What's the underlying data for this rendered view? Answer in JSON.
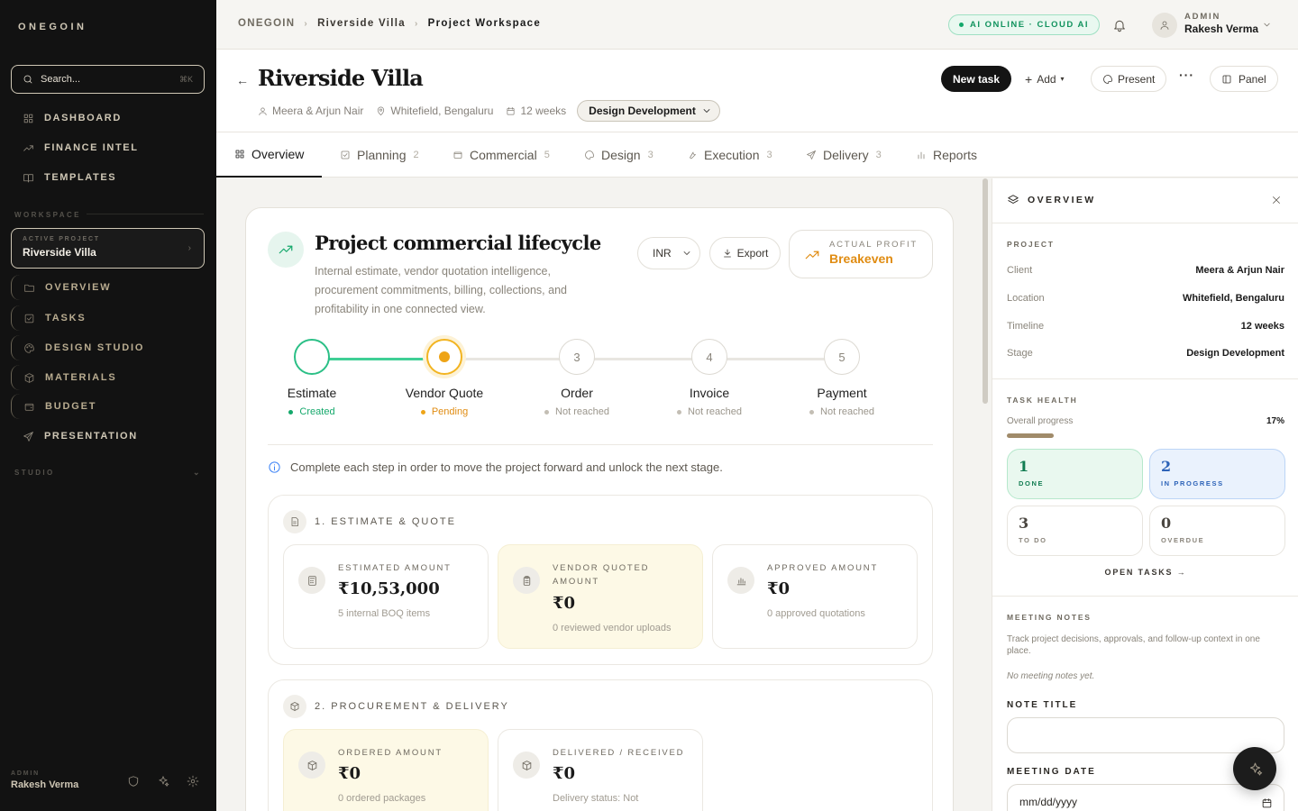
{
  "sidebar": {
    "brand": "ONEGOIN",
    "search_placeholder": "Search...",
    "search_shortcut": "⌘K",
    "nav": [
      {
        "label": "DASHBOARD",
        "icon": "grid-icon"
      },
      {
        "label": "FINANCE INTEL",
        "icon": "trend-icon"
      },
      {
        "label": "TEMPLATES",
        "icon": "book-icon"
      }
    ],
    "workspace_label": "WORKSPACE",
    "active_project_label": "ACTIVE PROJECT",
    "active_project_name": "Riverside Villa",
    "project_nav": [
      {
        "label": "OVERVIEW",
        "icon": "folder-icon"
      },
      {
        "label": "TASKS",
        "icon": "check-square-icon"
      },
      {
        "label": "DESIGN STUDIO",
        "icon": "palette-icon"
      },
      {
        "label": "MATERIALS",
        "icon": "box-icon"
      },
      {
        "label": "BUDGET",
        "icon": "wallet-icon"
      },
      {
        "label": "PRESENTATION",
        "icon": "send-icon"
      }
    ],
    "studio_label": "STUDIO",
    "footer_role": "ADMIN",
    "footer_user": "Rakesh Verma"
  },
  "topbar": {
    "breadcrumbs": [
      "ONEGOIN",
      "Riverside Villa",
      "Project Workspace"
    ],
    "ai_status": "AI ONLINE · CLOUD AI",
    "user_role": "ADMIN",
    "user_name": "Rakesh Verma"
  },
  "header": {
    "back": "←",
    "title": "Riverside Villa",
    "client": "Meera & Arjun Nair",
    "location": "Whitefield, Bengaluru",
    "duration": "12 weeks",
    "stage": "Design Development",
    "new_task": "New task",
    "add": "Add",
    "present": "Present",
    "more": "···",
    "panel": "Panel"
  },
  "tabs": [
    {
      "label": "Overview",
      "count": ""
    },
    {
      "label": "Planning",
      "count": "2"
    },
    {
      "label": "Commercial",
      "count": "5"
    },
    {
      "label": "Design",
      "count": "3"
    },
    {
      "label": "Execution",
      "count": "3"
    },
    {
      "label": "Delivery",
      "count": "3"
    },
    {
      "label": "Reports",
      "count": ""
    }
  ],
  "lifecycle": {
    "title": "Project commercial lifecycle",
    "description": "Internal estimate, vendor quotation intelligence, procurement commitments, billing, collections, and profitability in one connected view.",
    "currency": "INR",
    "export": "Export",
    "profit_label": "ACTUAL PROFIT",
    "profit_value": "Breakeven",
    "steps": [
      {
        "num": "",
        "name": "Estimate",
        "status": "Created"
      },
      {
        "num": "",
        "name": "Vendor Quote",
        "status": "Pending"
      },
      {
        "num": "3",
        "name": "Order",
        "status": "Not reached"
      },
      {
        "num": "4",
        "name": "Invoice",
        "status": "Not reached"
      },
      {
        "num": "5",
        "name": "Payment",
        "status": "Not reached"
      }
    ],
    "info": "Complete each step in order to move the project forward and unlock the next stage.",
    "group1": {
      "title": "1. ESTIMATE & QUOTE",
      "cards": [
        {
          "label": "ESTIMATED AMOUNT",
          "value": "₹10,53,000",
          "sub": "5 internal BOQ items"
        },
        {
          "label": "VENDOR QUOTED AMOUNT",
          "value": "₹0",
          "sub": "0 reviewed vendor uploads"
        },
        {
          "label": "APPROVED AMOUNT",
          "value": "₹0",
          "sub": "0 approved quotations"
        }
      ]
    },
    "group2": {
      "title": "2. PROCUREMENT & DELIVERY",
      "cards": [
        {
          "label": "ORDERED AMOUNT",
          "value": "₹0",
          "sub": "0 ordered packages"
        },
        {
          "label": "DELIVERED / RECEIVED",
          "value": "₹0",
          "sub": "Delivery status: Not"
        }
      ]
    }
  },
  "panel": {
    "title": "OVERVIEW",
    "project_label": "PROJECT",
    "rows": [
      {
        "k": "Client",
        "v": "Meera & Arjun Nair"
      },
      {
        "k": "Location",
        "v": "Whitefield, Bengaluru"
      },
      {
        "k": "Timeline",
        "v": "12 weeks"
      },
      {
        "k": "Stage",
        "v": "Design Development"
      }
    ],
    "task_health_label": "TASK HEALTH",
    "overall_progress_label": "Overall progress",
    "overall_progress": "17%",
    "overall_progress_fraction": 0.17,
    "task_cards": [
      {
        "n": "1",
        "l": "DONE"
      },
      {
        "n": "2",
        "l": "IN PROGRESS"
      },
      {
        "n": "3",
        "l": "TO DO"
      },
      {
        "n": "0",
        "l": "OVERDUE"
      }
    ],
    "open_tasks": "OPEN TASKS →",
    "meeting_label": "MEETING NOTES",
    "meeting_desc": "Track project decisions, approvals, and follow-up context in one place.",
    "meeting_empty": "No meeting notes yet.",
    "note_title_label": "NOTE TITLE",
    "note_title_value": "",
    "meeting_date_label": "MEETING DATE",
    "meeting_date_placeholder": "mm/dd/yyyy"
  }
}
